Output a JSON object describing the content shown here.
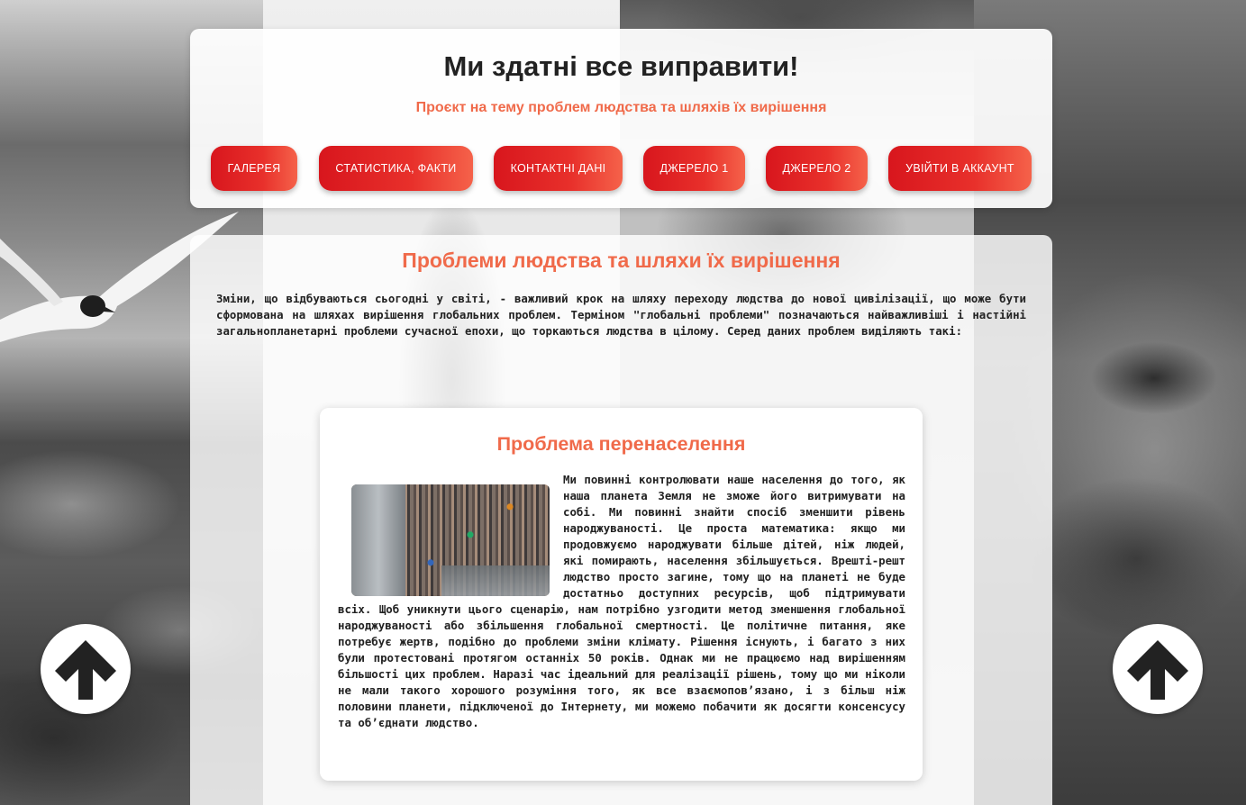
{
  "header": {
    "title": "Ми здатні все виправити!",
    "subtitle": "Проєкт на тему проблем людства та шляхів їх вирішення"
  },
  "nav": {
    "items": [
      {
        "label": "ГАЛЕРЕЯ"
      },
      {
        "label": "СТАТИСТИКА, ФАКТИ"
      },
      {
        "label": "КОНТАКТНІ ДАНІ"
      },
      {
        "label": "ДЖЕРЕЛО 1"
      },
      {
        "label": "ДЖЕРЕЛО 2"
      },
      {
        "label": "УВІЙТИ В АККАУНТ"
      }
    ],
    "gradient": [
      "#d8161d",
      "#f5624a"
    ]
  },
  "main": {
    "heading": "Проблеми людства та шляхи їх вирішення",
    "intro": "Зміни, що відбуваються сьогодні у світі, - важливий крок на шляху переходу людства до нової цивілізації, що може бути сформована на шляхах вирішення глобальних проблем. Терміном \"глобальні проблеми\" позначаються найважливіші і настійні загальнопланетарні проблеми сучасної епохи, що торкаються людства в цілому. Серед даних проблем виділяють такі:"
  },
  "problem": {
    "heading": "Проблема перенаселення",
    "image_icon": "crowded-train-photo",
    "text": "Ми повинні контролювати наше населення до того, як наша планета Земля не зможе його витримувати на собі. Ми повинні знайти спосіб зменшити рівень народжуваності. Це проста математика: якщо ми продовжуємо народжувати більше дітей, ніж людей, які помирають, населення збільшується. Врешті-решт людство просто загине, тому що на планеті не буде достатньо доступних ресурсів, щоб підтримувати всіх. Щоб уникнути цього сценарію, нам потрібно узгодити метод зменшення глобальної народжуваності або збільшення глобальної смертності. Це політичне питання, яке потребує жертв, подібно до проблеми зміни клімату. Рішення існують, і багато з них були протестовані протягом останніх 50 років. Однак ми не працюємо над вирішенням більшості цих проблем. Наразі час ідеальний для реалізації рішень, тому що ми ніколи не мали такого хорошого розуміння того, як все взаємопов’язано, і з більш ніж половини планети, підключеної до Інтернету, ми можемо побачити як досягти консенсусу та об’єднати людство."
  },
  "colors": {
    "accent": "#f06a4a",
    "text": "#222222"
  },
  "scroll_buttons": {
    "icon": "arrow-up-icon"
  }
}
